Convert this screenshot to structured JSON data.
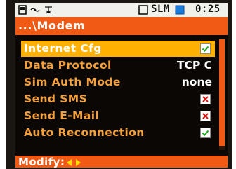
{
  "status_bar": {
    "icons": [
      "battery-icon",
      "signal-icon",
      "transmit-icon"
    ],
    "mode": "SLM",
    "time": "0:25"
  },
  "path": {
    "label": "...\\Modem"
  },
  "menu": {
    "items": [
      {
        "label": "Internet Cfg",
        "control": "checkbox",
        "checked": true,
        "selected": true
      },
      {
        "label": "Data Protocol",
        "value": "TCP C"
      },
      {
        "label": "Sim Auth Mode",
        "value": "none"
      },
      {
        "label": "Send SMS",
        "control": "checkbox",
        "checked": false
      },
      {
        "label": "Send E-Mail",
        "control": "checkbox",
        "checked": false
      },
      {
        "label": "Auto Reconnection",
        "control": "checkbox",
        "checked": true
      }
    ]
  },
  "footer": {
    "label": "Modify:",
    "icons": [
      "arrow-left-icon",
      "arrow-right-icon"
    ]
  },
  "colors": {
    "accent": "#f05a14",
    "selection": "#ffb000",
    "label": "#f4a03c",
    "background": "#0b0704",
    "check_on": "#1aa01a",
    "check_off": "#e01010"
  }
}
